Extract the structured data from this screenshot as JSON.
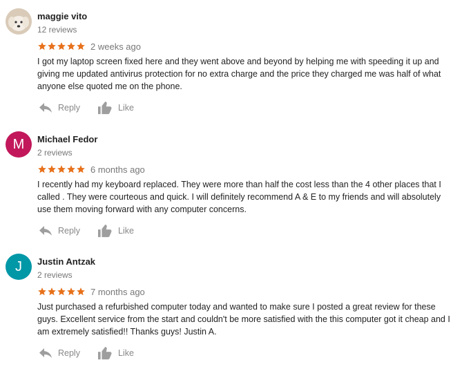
{
  "colors": {
    "star": "#e7711b",
    "avatar_m": "#c2185b",
    "avatar_j": "#0097a7"
  },
  "actions": {
    "reply_label": "Reply",
    "like_label": "Like"
  },
  "reviews": [
    {
      "name": "maggie vito",
      "count": "12 reviews",
      "ago": "2 weeks ago",
      "avatar": "photo",
      "stars": 5,
      "text": "I got my laptop screen fixed here and they went above and beyond by helping me with speeding it up and giving me updated antivirus protection for no extra charge and the price they charged me was half of what anyone else quoted me on the phone."
    },
    {
      "name": "Michael Fedor",
      "count": "2 reviews",
      "ago": "6 months ago",
      "avatar": "M",
      "stars": 5,
      "text": "I recently had my keyboard replaced.  They were more than half the cost less than the 4 other places that I called .  They were courteous and quick. I will definitely recommend A & E to my friends and will absolutely use them moving forward with any computer concerns."
    },
    {
      "name": "Justin Antzak",
      "count": "2 reviews",
      "ago": "7 months ago",
      "avatar": "J",
      "stars": 5,
      "text": "Just purchased a refurbished computer today and wanted to make sure I posted a great review for these guys.  Excellent service from the start and couldn't be more satisfied with the this computer got it cheap and I am extremely satisfied!!  Thanks guys!  Justin A."
    }
  ]
}
